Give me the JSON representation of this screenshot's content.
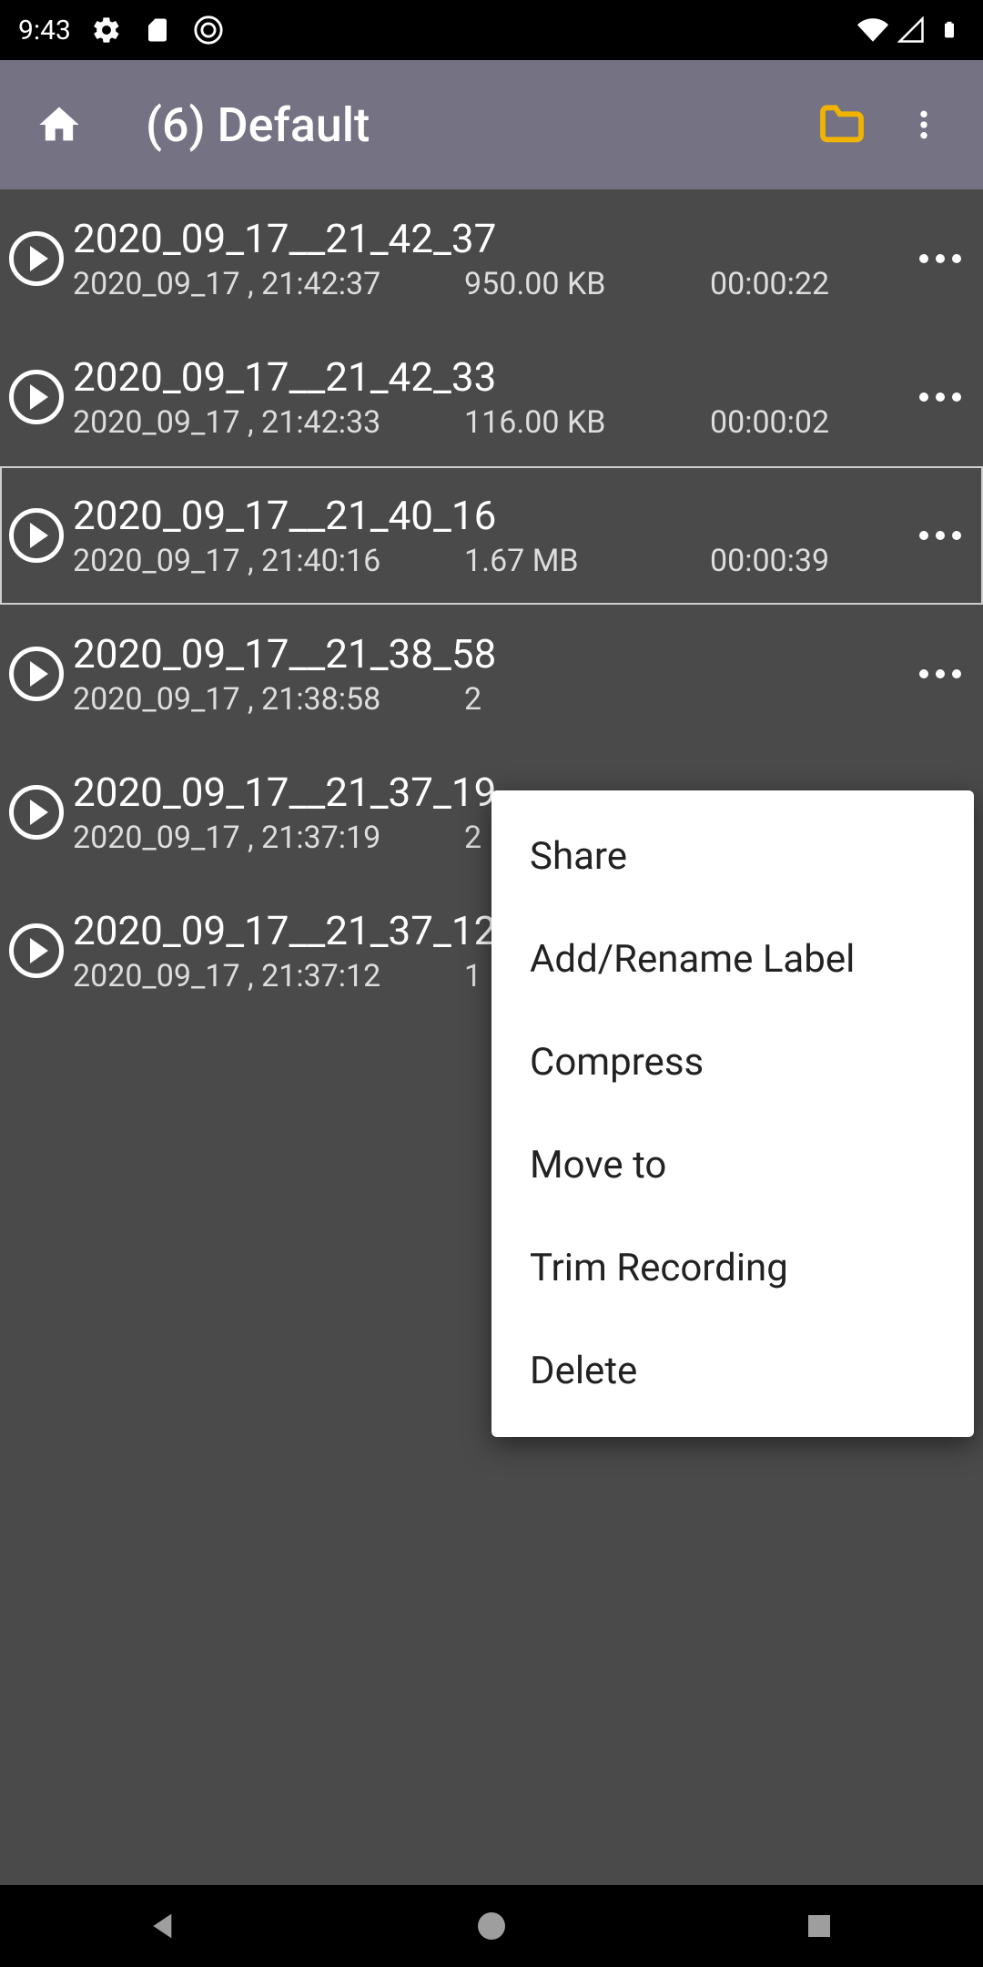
{
  "status": {
    "time": "9:43"
  },
  "header": {
    "title": "(6) Default"
  },
  "items": [
    {
      "title": "2020_09_17__21_42_37",
      "date": "2020_09_17 , 21:42:37",
      "size": "950.00 KB",
      "dur": "00:00:22"
    },
    {
      "title": "2020_09_17__21_42_33",
      "date": "2020_09_17 , 21:42:33",
      "size": "116.00 KB",
      "dur": "00:00:02"
    },
    {
      "title": "2020_09_17__21_40_16",
      "date": "2020_09_17 , 21:40:16",
      "size": "1.67 MB",
      "dur": "00:00:39"
    },
    {
      "title": "2020_09_17__21_38_58",
      "date": "2020_09_17 , 21:38:58",
      "size": "2",
      "dur": ""
    },
    {
      "title": "2020_09_17__21_37_19",
      "date": "2020_09_17 , 21:37:19",
      "size": "2",
      "dur": ""
    },
    {
      "title": "2020_09_17__21_37_12",
      "date": "2020_09_17 , 21:37:12",
      "size": "1",
      "dur": ""
    }
  ],
  "popup": {
    "share": "Share",
    "rename": "Add/Rename Label",
    "compress": "Compress",
    "moveto": "Move to",
    "trim": "Trim Recording",
    "delete": "Delete"
  }
}
